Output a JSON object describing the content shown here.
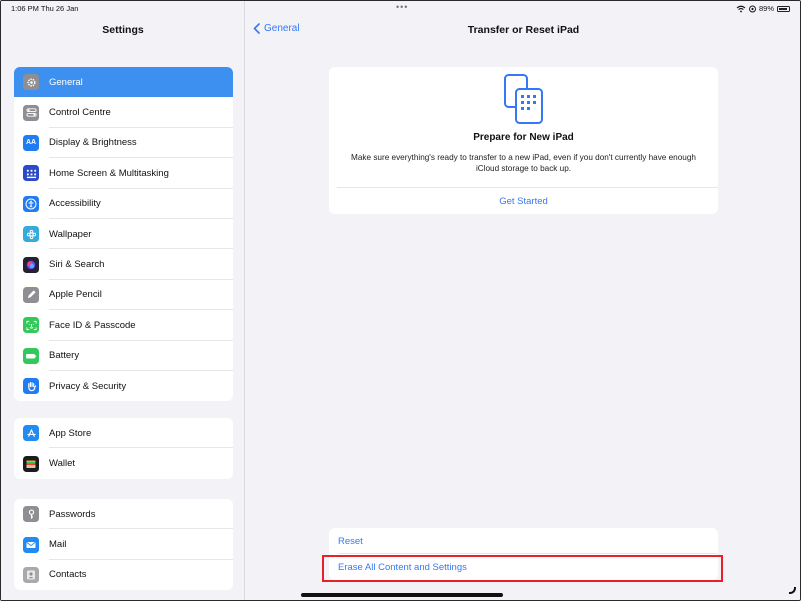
{
  "status_bar": {
    "time_date": "1:06 PM  Thu 26 Jan",
    "battery": "89%"
  },
  "sidebar": {
    "title": "Settings",
    "groups": [
      [
        {
          "label": "General",
          "icon": "gear-icon",
          "color": "#8e8e93"
        },
        {
          "label": "Control Centre",
          "icon": "toggles-icon",
          "color": "#8e8e93"
        },
        {
          "label": "Display & Brightness",
          "icon": "display-icon",
          "color": "#1f7cf2"
        },
        {
          "label": "Home Screen & Multitasking",
          "icon": "grid-icon",
          "color": "#2c49c9"
        },
        {
          "label": "Accessibility",
          "icon": "accessibility-icon",
          "color": "#1f7cf2"
        },
        {
          "label": "Wallpaper",
          "icon": "wallpaper-icon",
          "color": "#35aadc"
        },
        {
          "label": "Siri & Search",
          "icon": "siri-icon",
          "color": "#222233"
        },
        {
          "label": "Apple Pencil",
          "icon": "pencil-icon",
          "color": "#8e8e93"
        },
        {
          "label": "Face ID & Passcode",
          "icon": "face-id-icon",
          "color": "#34c759"
        },
        {
          "label": "Battery",
          "icon": "battery-icon",
          "color": "#34c759"
        },
        {
          "label": "Privacy & Security",
          "icon": "hand-icon",
          "color": "#1f7cf2"
        }
      ],
      [
        {
          "label": "App Store",
          "icon": "app-store-icon",
          "color": "#1f8bf3"
        },
        {
          "label": "Wallet",
          "icon": "wallet-icon",
          "color": "#1c1c1e"
        }
      ],
      [
        {
          "label": "Passwords",
          "icon": "key-icon",
          "color": "#8e8e93"
        },
        {
          "label": "Mail",
          "icon": "mail-icon",
          "color": "#1f8bf3"
        },
        {
          "label": "Contacts",
          "icon": "contacts-icon",
          "color": "#a8a8ad"
        }
      ]
    ]
  },
  "main": {
    "back_label": "General",
    "title": "Transfer or Reset iPad",
    "card": {
      "title": "Prepare for New iPad",
      "description": "Make sure everything's ready to transfer to a new iPad, even if you don't currently have enough iCloud storage to back up.",
      "link": "Get Started"
    },
    "reset_label": "Reset",
    "erase_label": "Erase All Content and Settings"
  },
  "colors": {
    "accent": "#3478f6",
    "selected": "#3d8ff0",
    "highlight": "#e8202a"
  }
}
